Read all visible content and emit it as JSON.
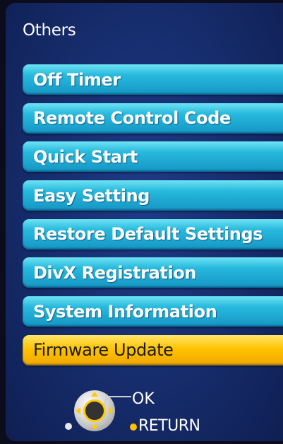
{
  "menu": {
    "title": "Others",
    "items": [
      {
        "label": "Off Timer",
        "selected": false
      },
      {
        "label": "Remote Control Code",
        "selected": false
      },
      {
        "label": "Quick Start",
        "selected": false
      },
      {
        "label": "Easy Setting",
        "selected": false
      },
      {
        "label": "Restore Default Settings",
        "selected": false
      },
      {
        "label": "DivX Registration",
        "selected": false
      },
      {
        "label": "System Information",
        "selected": false
      },
      {
        "label": "Firmware Update",
        "selected": true
      }
    ]
  },
  "legend": {
    "ok_label": "OK",
    "return_label": "RETURN",
    "icons": [
      "dpad-icon",
      "return-dot-icon"
    ]
  },
  "colors": {
    "background": "#162c6c",
    "item": "#27b9dd",
    "selected": "#ffc300",
    "text": "#ffffff"
  }
}
